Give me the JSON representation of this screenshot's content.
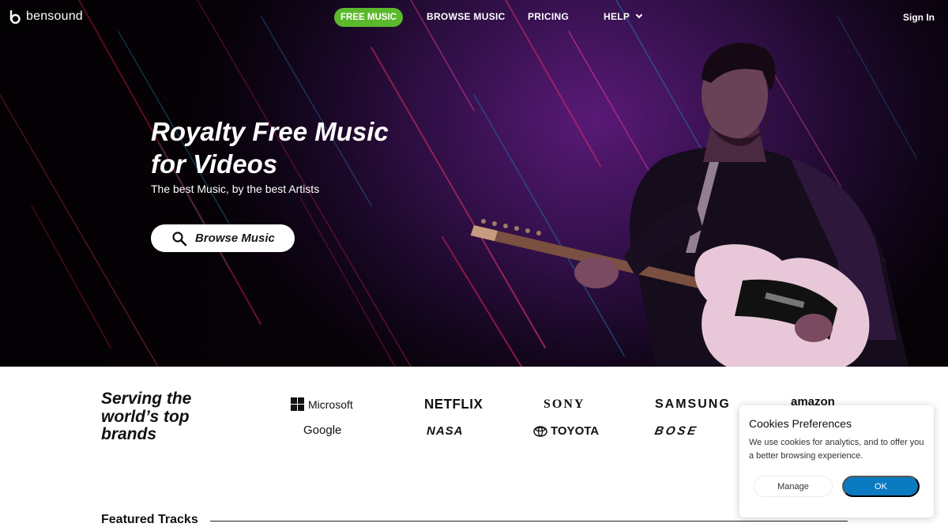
{
  "nav": {
    "logo_text": "bensound",
    "items": [
      {
        "label": "FREE MUSIC",
        "active": true
      },
      {
        "label": "BROWSE MUSIC"
      },
      {
        "label": "PRICING"
      },
      {
        "label": "HELP"
      }
    ],
    "sign_in": "Sign In",
    "active_color": "#5cb82c"
  },
  "hero": {
    "title_line1": "Royalty Free Music",
    "title_line2": "for Videos",
    "subtitle": "The best Music, by the best Artists",
    "browse_button": "Browse Music"
  },
  "brands": {
    "title": "Serving the world’s top brands",
    "logos": [
      "Microsoft",
      "NETFLIX",
      "SONY",
      "SAMSUNG",
      "amazon",
      "Google",
      "NASA",
      "TOYOTA",
      "BOSE"
    ]
  },
  "featured": {
    "title": "Featured Tracks"
  },
  "cookies": {
    "title": "Cookies Preferences",
    "text": "We use cookies for analytics, and to offer you a better browsing experience.",
    "manage": "Manage",
    "ok": "OK",
    "ok_color": "#0a7bc1"
  },
  "icons": {
    "logo": "bensound-logo-icon",
    "search": "search-icon",
    "help_chevron": "chevron-down-icon"
  }
}
